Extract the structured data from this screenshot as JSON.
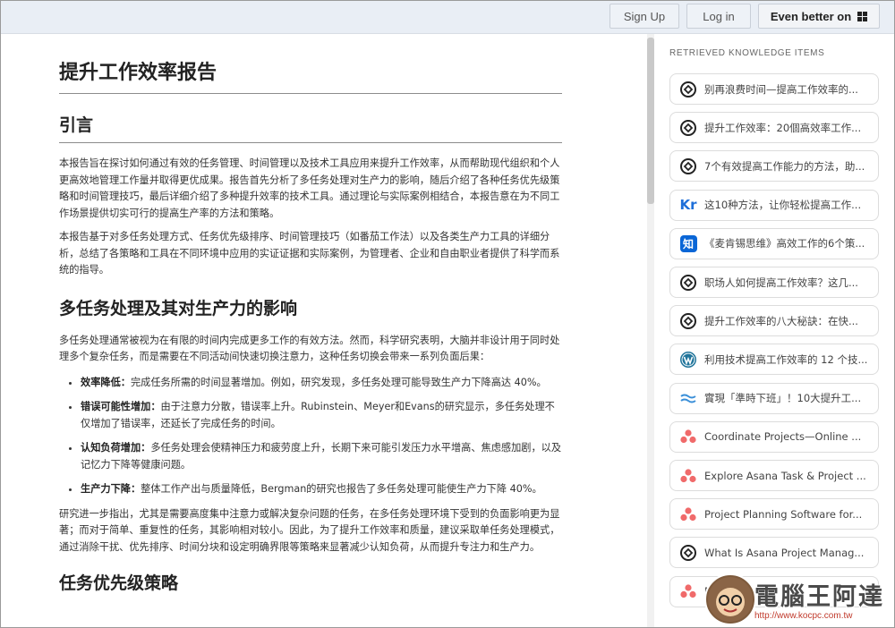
{
  "topbar": {
    "signup_label": "Sign Up",
    "login_label": "Log in",
    "better_label": "Even better on"
  },
  "article": {
    "title": "提升工作效率报告",
    "sections": {
      "intro_heading": "引言",
      "intro_p1": "本报告旨在探讨如何通过有效的任务管理、时间管理以及技术工具应用来提升工作效率，从而帮助现代组织和个人更高效地管理工作量并取得更优成果。报告首先分析了多任务处理对生产力的影响，随后介绍了各种任务优先级策略和时间管理技巧，最后详细介绍了多种提升效率的技术工具。通过理论与实际案例相结合，本报告意在为不同工作场景提供切实可行的提高生产率的方法和策略。",
      "intro_p2": "本报告基于对多任务处理方式、任务优先级排序、时间管理技巧（如番茄工作法）以及各类生产力工具的详细分析，总结了各策略和工具在不同环境中应用的实证证据和实际案例，为管理者、企业和自由职业者提供了科学而系统的指导。",
      "multi_heading": "多任务处理及其对生产力的影响",
      "multi_p1": "多任务处理通常被视为在有限的时间内完成更多工作的有效方法。然而，科学研究表明，大脑并非设计用于同时处理多个复杂任务，而是需要在不同活动间快速切换注意力，这种任务切换会带来一系列负面后果：",
      "bullets": [
        {
          "term": "效率降低：",
          "text": "完成任务所需的时间显著增加。例如，研究发现，多任务处理可能导致生产力下降高达 40%。"
        },
        {
          "term": "错误可能性增加：",
          "text": "由于注意力分散，错误率上升。Rubinstein、Meyer和Evans的研究显示，多任务处理不仅增加了错误率，还延长了完成任务的时间。"
        },
        {
          "term": "认知负荷增加：",
          "text": "多任务处理会使精神压力和疲劳度上升，长期下来可能引发压力水平增高、焦虑感加剧，以及记忆力下降等健康问题。"
        },
        {
          "term": "生产力下降：",
          "text": "整体工作产出与质量降低，Bergman的研究也报告了多任务处理可能使生产力下降 40%。"
        }
      ],
      "multi_p2": "研究进一步指出，尤其是需要高度集中注意力或解决复杂问题的任务，在多任务处理环境下受到的负面影响更为显著；而对于简单、重复性的任务，其影响相对较小。因此，为了提升工作效率和质量，建议采取单任务处理模式，通过消除干扰、优先排序、时间分块和设定明确界限等策略来显著减少认知负荷，从而提升专注力和生产力。",
      "priority_heading": "任务优先级策略"
    }
  },
  "sidebar": {
    "title": "RETRIEVED KNOWLEDGE ITEMS",
    "items": [
      {
        "icon": "chatgpt-icon",
        "label": "别再浪费时间—提高工作效率的..."
      },
      {
        "icon": "chatgpt-icon",
        "label": "提升工作效率：20個高效率工作..."
      },
      {
        "icon": "chatgpt-icon",
        "label": "7个有效提高工作能力的方法，助..."
      },
      {
        "icon": "kr-icon",
        "label": "这10种方法，让你轻松提高工作..."
      },
      {
        "icon": "zhihu-icon",
        "label": "《麦肯锡思维》高效工作的6个策..."
      },
      {
        "icon": "chatgpt-icon",
        "label": "职场人如何提高工作效率？这几..."
      },
      {
        "icon": "chatgpt-icon",
        "label": "提升工作效率的八大秘訣：在快..."
      },
      {
        "icon": "wordpress-icon",
        "label": "利用技术提高工作效率的 12 个技..."
      },
      {
        "icon": "wave-icon",
        "label": "實現「準時下班」！10大提升工..."
      },
      {
        "icon": "asana-icon",
        "label": "Coordinate Projects—Online ..."
      },
      {
        "icon": "asana-icon",
        "label": "Explore Asana Task & Project ..."
      },
      {
        "icon": "asana-icon",
        "label": "Project Planning Software for..."
      },
      {
        "icon": "chatgpt-icon",
        "label": "What Is Asana Project Manag..."
      },
      {
        "icon": "asana-icon",
        "label": "Mo..."
      }
    ]
  },
  "watermark": {
    "text": "電腦王阿達",
    "url": "http://www.kocpc.com.tw"
  }
}
